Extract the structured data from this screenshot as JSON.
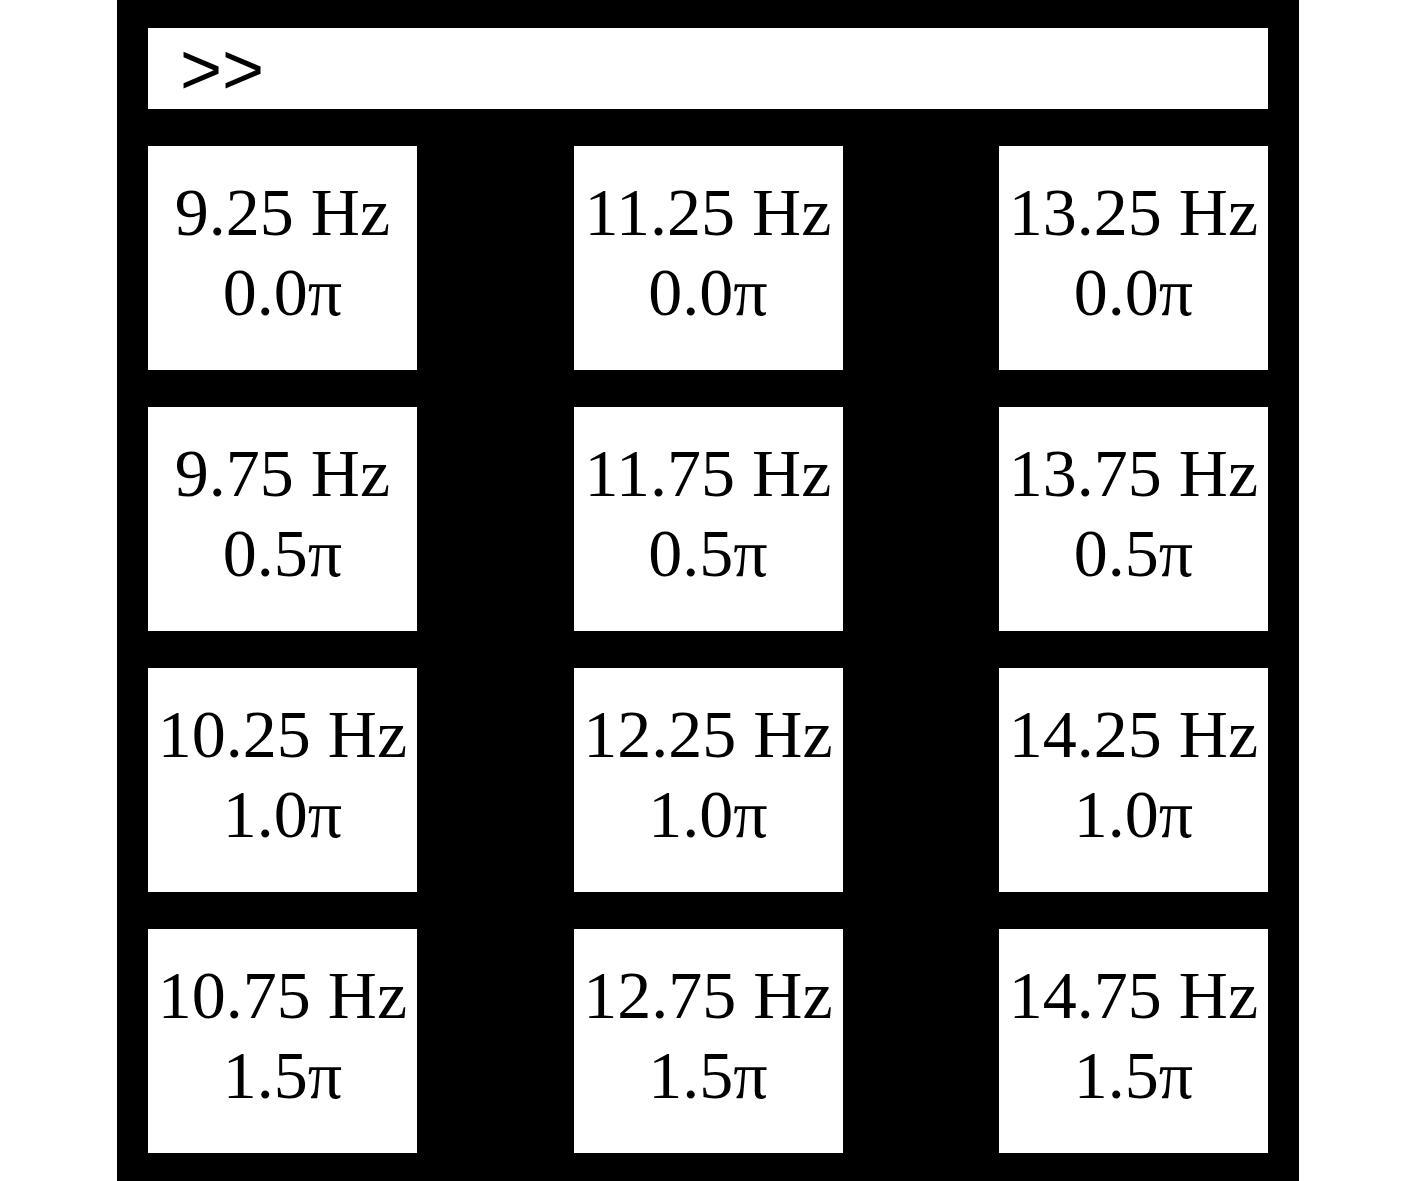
{
  "command_bar": {
    "prompt": ">>"
  },
  "targets": [
    {
      "frequency": "9.25 Hz",
      "phase": "0.0π"
    },
    {
      "frequency": "11.25 Hz",
      "phase": "0.0π"
    },
    {
      "frequency": "13.25 Hz",
      "phase": "0.0π"
    },
    {
      "frequency": "9.75 Hz",
      "phase": "0.5π"
    },
    {
      "frequency": "11.75 Hz",
      "phase": "0.5π"
    },
    {
      "frequency": "13.75 Hz",
      "phase": "0.5π"
    },
    {
      "frequency": "10.25 Hz",
      "phase": "1.0π"
    },
    {
      "frequency": "12.25 Hz",
      "phase": "1.0π"
    },
    {
      "frequency": "14.25 Hz",
      "phase": "1.0π"
    },
    {
      "frequency": "10.75 Hz",
      "phase": "1.5π"
    },
    {
      "frequency": "12.75 Hz",
      "phase": "1.5π"
    },
    {
      "frequency": "14.75 Hz",
      "phase": "1.5π"
    }
  ]
}
